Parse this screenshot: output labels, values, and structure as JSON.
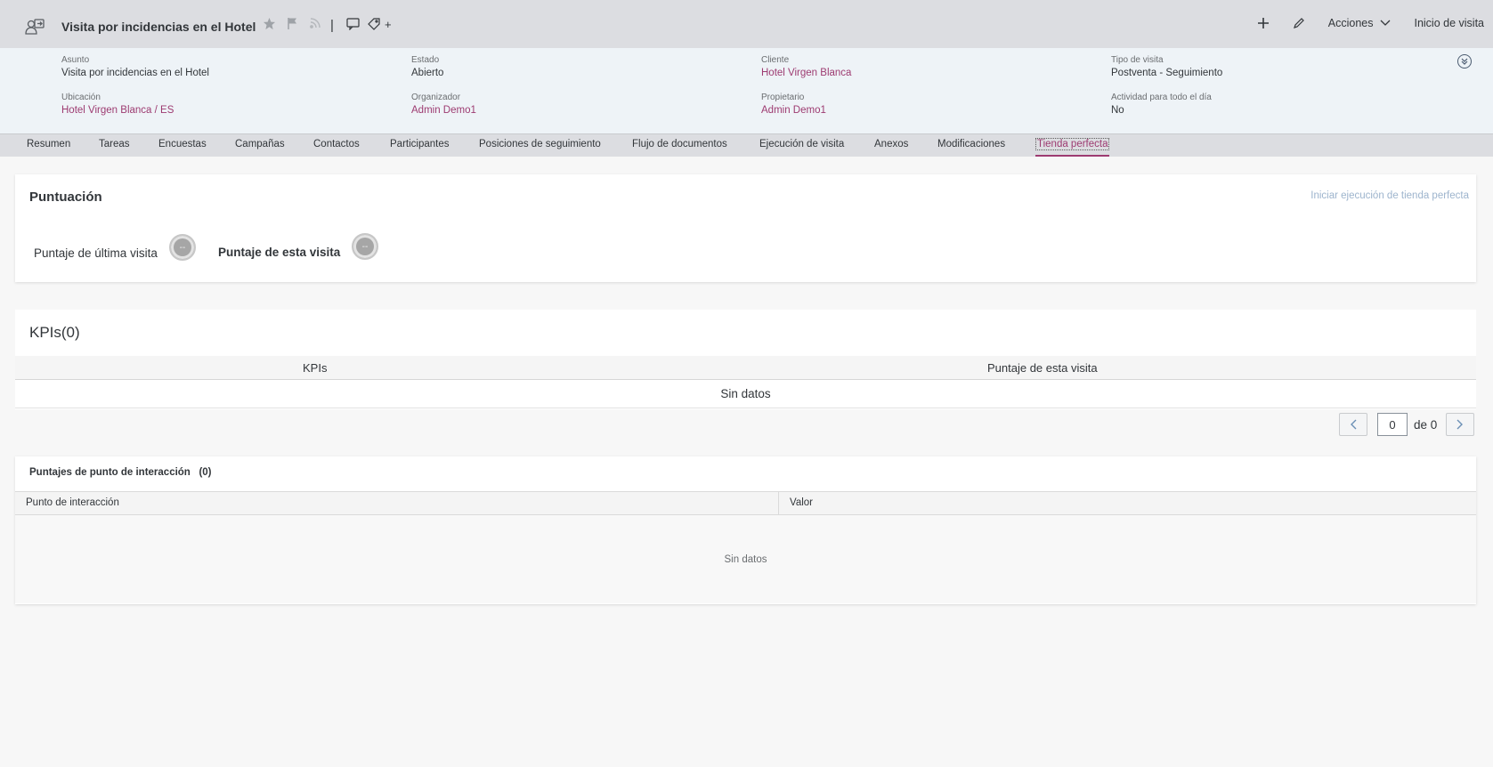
{
  "header": {
    "title": "Visita por incidencias en el Hotel",
    "separator": "|",
    "add_tag_label": "+",
    "actions_label": "Acciones",
    "home_label": "Inicio de visita",
    "icons": [
      "visit-object-icon",
      "star-icon",
      "flag-icon",
      "rss-icon",
      "comment-icon",
      "tag-icon",
      "add-icon",
      "edit-icon",
      "chevron-down-icon"
    ]
  },
  "attributes": [
    {
      "label": "Asunto",
      "value": "Visita por incidencias en el Hotel",
      "link": false
    },
    {
      "label": "Estado",
      "value": "Abierto",
      "link": false
    },
    {
      "label": "Cliente",
      "value": "Hotel Virgen Blanca",
      "link": true
    },
    {
      "label": "Tipo de visita",
      "value": "Postventa - Seguimiento",
      "link": false
    },
    {
      "label": "Ubicación",
      "value": "Hotel Virgen Blanca / ES",
      "link": true
    },
    {
      "label": "Organizador",
      "value": "Admin Demo1",
      "link": true
    },
    {
      "label": "Propietario",
      "value": "Admin Demo1",
      "link": true
    },
    {
      "label": "Actividad para todo el día",
      "value": "No",
      "link": false
    }
  ],
  "tabs": [
    {
      "label": "Resumen"
    },
    {
      "label": "Tareas"
    },
    {
      "label": "Encuestas"
    },
    {
      "label": "Campañas"
    },
    {
      "label": "Contactos"
    },
    {
      "label": "Participantes"
    },
    {
      "label": "Posiciones de seguimiento"
    },
    {
      "label": "Flujo de documentos"
    },
    {
      "label": "Ejecución de visita"
    },
    {
      "label": "Anexos"
    },
    {
      "label": "Modificaciones"
    },
    {
      "label": "Tienda perfecta",
      "active": true
    }
  ],
  "score": {
    "title": "Puntuación",
    "action_label": "Iniciar ejecución de tienda perfecta",
    "last_visit_label": "Puntaje de última visita",
    "last_visit_value": "--",
    "this_visit_label": "Puntaje de esta visita",
    "this_visit_value": "--"
  },
  "kpis": {
    "title": "KPIs(0)",
    "columns": [
      "KPIs",
      "Puntaje de esta visita"
    ],
    "empty_text": "Sin datos",
    "pager": {
      "current": "0",
      "of_label": "de 0"
    }
  },
  "interaction": {
    "title": "Puntajes de punto de interacción",
    "count": "(0)",
    "columns": [
      "Punto de interacción",
      "Valor"
    ],
    "empty_text": "Sin datos"
  },
  "colors": {
    "accent": "#9d3b71",
    "header_bg": "#dcdde1",
    "attr_bg": "#eef3f7",
    "disabled_link": "#9db4cd"
  }
}
